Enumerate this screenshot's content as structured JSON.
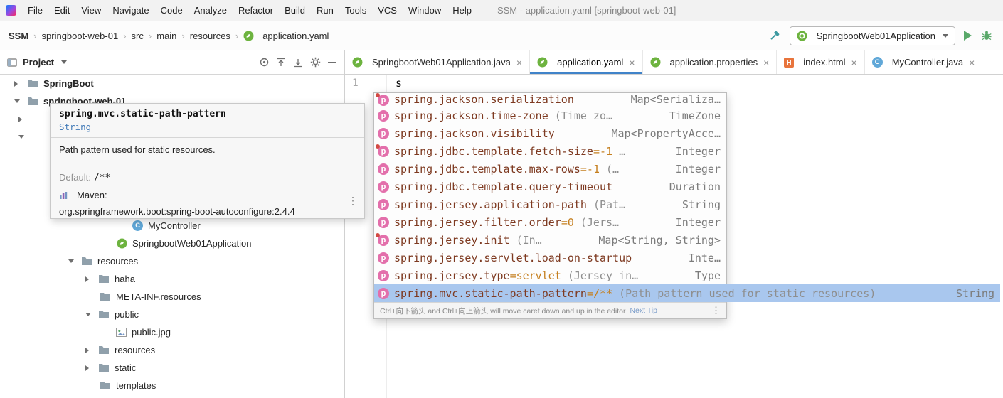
{
  "colors": {
    "accent_blue": "#4083c9",
    "selection_blue": "#a9c7ee",
    "spring_green": "#6db33f",
    "run_green": "#59a869",
    "property_icon_pink": "#e36fab",
    "property_name_brown": "#7e3a21",
    "property_value_orange": "#c57f1f"
  },
  "menubar": {
    "items": [
      "File",
      "Edit",
      "View",
      "Navigate",
      "Code",
      "Analyze",
      "Refactor",
      "Build",
      "Run",
      "Tools",
      "VCS",
      "Window",
      "Help"
    ],
    "title": "SSM - application.yaml [springboot-web-01]"
  },
  "breadcrumbs": {
    "items": [
      "SSM",
      "springboot-web-01",
      "src",
      "main",
      "resources"
    ],
    "file": "application.yaml"
  },
  "run_widget": {
    "config_name": "SpringbootWeb01Application"
  },
  "project_panel": {
    "title": "Project",
    "tree": [
      {
        "label": "SpringBoot",
        "icon": "folder-icon",
        "chevron": "right",
        "bold": true
      },
      {
        "label": "springboot-web-01",
        "icon": "folder-icon",
        "chevron": "down",
        "bold": true
      },
      {
        "label": "",
        "icon": "",
        "chevron": "right",
        "bold": false
      },
      {
        "label": "",
        "icon": "",
        "chevron": "down",
        "bold": false
      },
      {
        "label": "",
        "icon": "",
        "chevron": "",
        "bold": false
      },
      {
        "label": "",
        "icon": "",
        "chevron": "",
        "bold": false
      },
      {
        "label": "",
        "icon": "",
        "chevron": "",
        "bold": false
      },
      {
        "label": "",
        "icon": "",
        "chevron": "",
        "bold": false
      },
      {
        "label": "MyController",
        "icon": "class-icon",
        "chevron": "",
        "bold": false
      },
      {
        "label": "SpringbootWeb01Application",
        "icon": "spring-boot-class-icon",
        "chevron": "",
        "bold": false
      },
      {
        "label": "resources",
        "icon": "folder-icon",
        "chevron": "down",
        "bold": false
      },
      {
        "label": "haha",
        "icon": "folder-icon",
        "chevron": "right",
        "bold": false
      },
      {
        "label": "META-INF.resources",
        "icon": "folder-icon",
        "chevron": "",
        "bold": false
      },
      {
        "label": "public",
        "icon": "folder-icon",
        "chevron": "down",
        "bold": false
      },
      {
        "label": "public.jpg",
        "icon": "image-icon",
        "chevron": "",
        "bold": false
      },
      {
        "label": "resources",
        "icon": "folder-icon",
        "chevron": "right",
        "bold": false
      },
      {
        "label": "static",
        "icon": "folder-icon",
        "chevron": "right",
        "bold": false
      },
      {
        "label": "templates",
        "icon": "folder-icon",
        "chevron": "",
        "bold": false
      }
    ]
  },
  "tabs": [
    {
      "label": "SpringbootWeb01Application.java",
      "icon": "spring-boot-class-icon",
      "active": false
    },
    {
      "label": "application.yaml",
      "icon": "spring-leaf-icon",
      "active": true
    },
    {
      "label": "application.properties",
      "icon": "spring-leaf-icon",
      "active": false
    },
    {
      "label": "index.html",
      "icon": "html-file-icon",
      "active": false
    },
    {
      "label": "MyController.java",
      "icon": "class-icon",
      "active": false
    }
  ],
  "editor": {
    "line_number": "1",
    "code": "s"
  },
  "doc_popup": {
    "title": "spring.mvc.static-path-pattern",
    "type": "String",
    "description": "Path pattern used for static resources.",
    "default_label": "Default:",
    "default_value": "/**",
    "maven_label": "Maven:",
    "maven_coordinates": "org.springframework.boot:spring-boot-autoconfigure:2.4.4"
  },
  "completion": {
    "items": [
      {
        "name": "spring.jackson.serialization",
        "value": "",
        "desc": "",
        "type": "Map<Serializa…"
      },
      {
        "name": "spring.jackson.time-zone",
        "value": "",
        "desc": "(Time zo…",
        "type": "TimeZone"
      },
      {
        "name": "spring.jackson.visibility",
        "value": "",
        "desc": "",
        "type": "Map<PropertyAcce…"
      },
      {
        "name": "spring.jdbc.template.fetch-size",
        "value": "=-1",
        "desc": "…",
        "type": "Integer"
      },
      {
        "name": "spring.jdbc.template.max-rows",
        "value": "=-1",
        "desc": "(…",
        "type": "Integer"
      },
      {
        "name": "spring.jdbc.template.query-timeout",
        "value": "",
        "desc": "",
        "type": "Duration"
      },
      {
        "name": "spring.jersey.application-path",
        "value": "",
        "desc": "(Pat…",
        "type": "String"
      },
      {
        "name": "spring.jersey.filter.order",
        "value": "=0",
        "desc": "(Jers…",
        "type": "Integer"
      },
      {
        "name": "spring.jersey.init",
        "value": "",
        "desc": "(In…",
        "type": "Map<String, String>"
      },
      {
        "name": "spring.jersey.servlet.load-on-startup",
        "value": "",
        "desc": "",
        "type": "Inte…"
      },
      {
        "name": "spring.jersey.type",
        "value": "=servlet",
        "desc": "(Jersey in…",
        "type": "Type"
      },
      {
        "name": "spring.mvc.static-path-pattern",
        "value": "=/**",
        "desc": "(Path pattern used for static resources)",
        "type": "String"
      }
    ],
    "hint_text": "Ctrl+向下箭头 and Ctrl+向上箭头 will move caret down and up in the editor",
    "hint_link": "Next Tip"
  }
}
